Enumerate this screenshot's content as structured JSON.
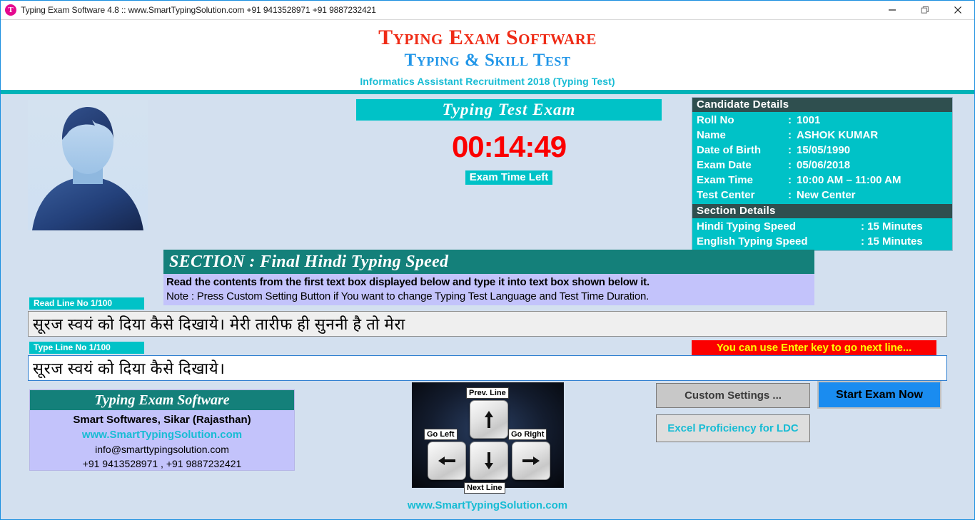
{
  "window": {
    "title": "Typing Exam Software 4.8 :: www.SmartTypingSolution.com  +91 9413528971  +91 9887232421",
    "icon_letter": "T",
    "icon": "app-logo-icon",
    "controls": {
      "minimize": "minimize-icon",
      "restore": "restore-icon",
      "close": "close-icon"
    }
  },
  "header": {
    "title": "Typing Exam Software",
    "subtitle": "Typing & Skill Test",
    "exam_line": "Informatics Assistant Recruitment 2018 (Typing Test)"
  },
  "exam": {
    "banner": "Typing Test Exam",
    "timer": "00:14:49",
    "timer_label": "Exam Time Left"
  },
  "candidate": {
    "panel_title": "Candidate Details",
    "rows": [
      {
        "key": "Roll No",
        "sep": ":",
        "value": "1001"
      },
      {
        "key": "Name",
        "sep": ":",
        "value": "ASHOK KUMAR"
      },
      {
        "key": "Date of Birth",
        "sep": ":",
        "value": "15/05/1990"
      },
      {
        "key": "Exam Date",
        "sep": ":",
        "value": "05/06/2018"
      },
      {
        "key": "Exam Time",
        "sep": ":",
        "value": "10:00 AM – 11:00 AM"
      },
      {
        "key": "Test Center",
        "sep": ":",
        "value": "New Center"
      }
    ]
  },
  "section_details": {
    "panel_title": "Section Details",
    "rows": [
      {
        "key": "Hindi Typing Speed",
        "value": ": 15 Minutes"
      },
      {
        "key": "English Typing Speed",
        "value": ": 15 Minutes"
      }
    ]
  },
  "section": {
    "bar": "SECTION : Final Hindi Typing Speed",
    "instruction_1": "Read the contents from the first text box displayed below and type it into text box shown below it.",
    "instruction_2": "Note : Press Custom Setting Button if You want to change Typing Test Language and Test Time Duration."
  },
  "lines": {
    "read_tag": "Read Line No 1/100",
    "read_text": "सूरज स्वयं को दिया कैसे दिखाये। मेरी तारीफ ही सुननी है तो मेरा",
    "type_tag": "Type Line No 1/100",
    "type_text": "सूरज स्वयं को दिया कैसे दिखाये।",
    "enter_hint": "You can use Enter key to go next line..."
  },
  "info_box": {
    "title": "Typing Exam Software",
    "company": "Smart Softwares, Sikar (Rajasthan)",
    "website": "www.SmartTypingSolution.com",
    "email": "info@smarttypingsolution.com",
    "phone": "+91 9413528971 , +91 9887232421"
  },
  "keys": {
    "up_label": "Prev. Line",
    "left_label": "Go Left",
    "down_label": "Next Line",
    "right_label": "Go Right"
  },
  "buttons": {
    "custom_settings": "Custom Settings ...",
    "excel_proficiency": "Excel Proficiency for LDC",
    "start_exam": "Start Exam Now"
  },
  "footer": {
    "url": "www.SmartTypingSolution.com"
  },
  "colors": {
    "background": "#d3e0ef",
    "teal": "#00c2c7",
    "dark_teal": "#14807a",
    "panel_header": "#2f4f4f",
    "red": "#fb0000",
    "brand_red": "#ef2b16",
    "brand_blue": "#2196e8",
    "cyan": "#18bcd4",
    "lavender": "#c3c3fb",
    "blue_button": "#1a8cf0",
    "yellow": "#ffff00"
  }
}
